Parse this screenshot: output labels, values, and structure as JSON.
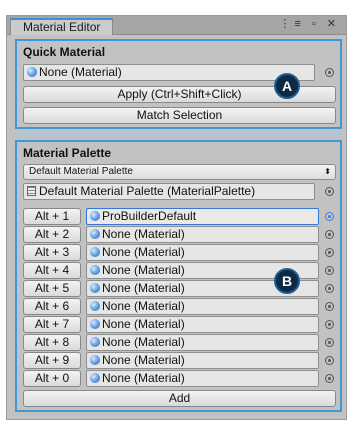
{
  "window": {
    "tab_title": "Material Editor",
    "controls": [
      "⋮≡",
      "▫",
      "✕"
    ]
  },
  "quick_material": {
    "title": "Quick Material",
    "material_field": "None (Material)",
    "apply_button": "Apply (Ctrl+Shift+Click)",
    "match_button": "Match Selection",
    "callout": "A"
  },
  "material_palette": {
    "title": "Material Palette",
    "palette_dropdown": "Default Material Palette",
    "palette_asset": "Default Material Palette (MaterialPalette)",
    "rows": [
      {
        "shortcut": "Alt + 1",
        "material": "ProBuilderDefault"
      },
      {
        "shortcut": "Alt + 2",
        "material": "None (Material)"
      },
      {
        "shortcut": "Alt + 3",
        "material": "None (Material)"
      },
      {
        "shortcut": "Alt + 4",
        "material": "None (Material)"
      },
      {
        "shortcut": "Alt + 5",
        "material": "None (Material)"
      },
      {
        "shortcut": "Alt + 6",
        "material": "None (Material)"
      },
      {
        "shortcut": "Alt + 7",
        "material": "None (Material)"
      },
      {
        "shortcut": "Alt + 8",
        "material": "None (Material)"
      },
      {
        "shortcut": "Alt + 9",
        "material": "None (Material)"
      },
      {
        "shortcut": "Alt + 0",
        "material": "None (Material)"
      }
    ],
    "add_button": "Add",
    "callout": "B"
  },
  "colors": {
    "highlight": "#3d9ad6",
    "selected_field": "#3577d6",
    "callout_bg": "#0d2a44"
  }
}
